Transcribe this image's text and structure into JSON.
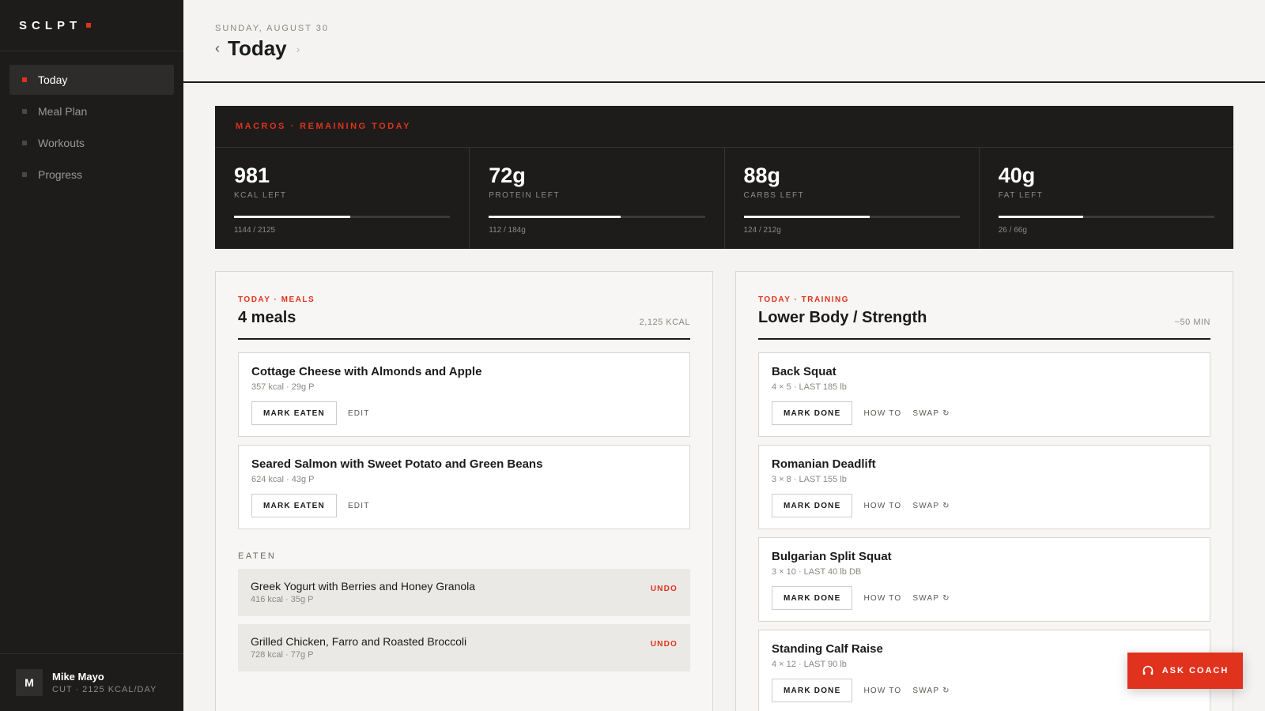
{
  "brand": {
    "name": "SCLPT",
    "accent": "#e0321c"
  },
  "nav": [
    {
      "label": "Today",
      "active": true
    },
    {
      "label": "Meal Plan",
      "active": false
    },
    {
      "label": "Workouts",
      "active": false
    },
    {
      "label": "Progress",
      "active": false
    }
  ],
  "user": {
    "initial": "M",
    "name": "Mike Mayo",
    "plan": "CUT · 2125 KCAL/DAY"
  },
  "header": {
    "date": "SUNDAY, AUGUST 30",
    "title": "Today",
    "prev_icon": "chevron-left-icon",
    "next_icon": "chevron-right-icon"
  },
  "macros": {
    "label": "MACROS · REMAINING TODAY",
    "items": [
      {
        "value": "981",
        "label": "KCAL LEFT",
        "progress": "1144 / 2125",
        "fraction": 0.538
      },
      {
        "value": "72g",
        "label": "PROTEIN LEFT",
        "progress": "112 / 184g",
        "fraction": 0.609
      },
      {
        "value": "88g",
        "label": "CARBS LEFT",
        "progress": "124 / 212g",
        "fraction": 0.585
      },
      {
        "value": "40g",
        "label": "FAT LEFT",
        "progress": "26 / 66g",
        "fraction": 0.394
      }
    ]
  },
  "meals": {
    "kicker": "TODAY · MEALS",
    "title": "4 meals",
    "meta": "2,125 KCAL",
    "upcoming": [
      {
        "name": "Cottage Cheese with Almonds and Apple",
        "sub": "357 kcal · 29g P",
        "primary": "MARK EATEN",
        "secondary": "EDIT"
      },
      {
        "name": "Seared Salmon with Sweet Potato and Green Beans",
        "sub": "624 kcal · 43g P",
        "primary": "MARK EATEN",
        "secondary": "EDIT"
      }
    ],
    "eaten_label": "EATEN",
    "eaten": [
      {
        "name": "Greek Yogurt with Berries and Honey Granola",
        "sub": "416 kcal · 35g P",
        "action": "UNDO"
      },
      {
        "name": "Grilled Chicken, Farro and Roasted Broccoli",
        "sub": "728 kcal · 77g P",
        "action": "UNDO"
      }
    ]
  },
  "training": {
    "kicker": "TODAY · TRAINING",
    "title": "Lower Body / Strength",
    "meta": "~50 MIN",
    "exercises": [
      {
        "name": "Back Squat",
        "sub": "4 × 5 · LAST 185 lb",
        "primary": "MARK DONE",
        "howto": "HOW TO",
        "swap": "SWAP ↻"
      },
      {
        "name": "Romanian Deadlift",
        "sub": "3 × 8 · LAST 155 lb",
        "primary": "MARK DONE",
        "howto": "HOW TO",
        "swap": "SWAP ↻"
      },
      {
        "name": "Bulgarian Split Squat",
        "sub": "3 × 10 · LAST 40 lb DB",
        "primary": "MARK DONE",
        "howto": "HOW TO",
        "swap": "SWAP ↻"
      },
      {
        "name": "Standing Calf Raise",
        "sub": "4 × 12 · LAST 90 lb",
        "primary": "MARK DONE",
        "howto": "HOW TO",
        "swap": "SWAP ↻"
      }
    ]
  },
  "ask_coach": {
    "label": "ASK COACH",
    "icon": "headset-icon"
  }
}
